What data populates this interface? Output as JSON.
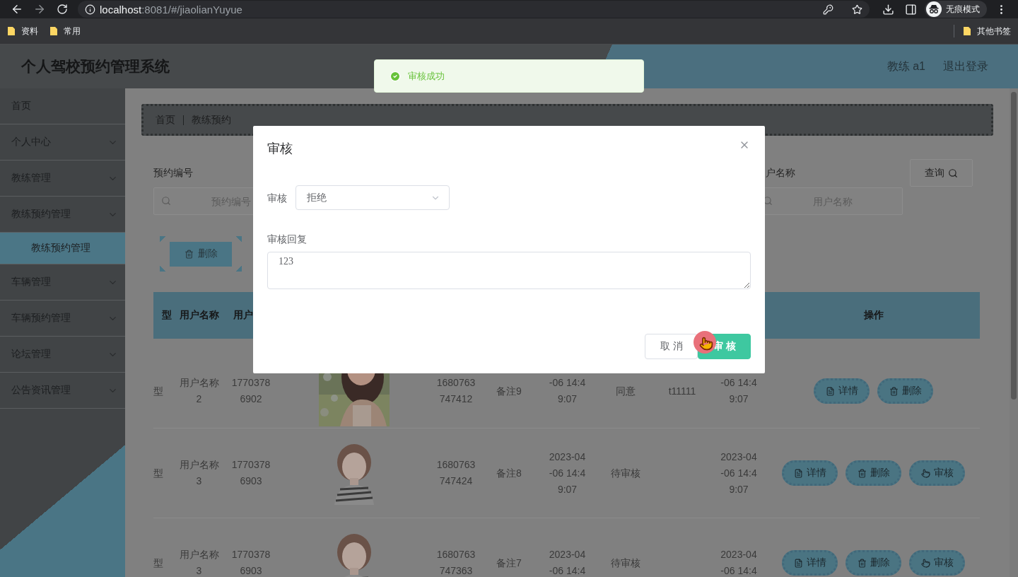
{
  "browser": {
    "url_host": "localhost",
    "url_path": ":8081/#/jiaolianYuyue",
    "profile_label": "无痕模式",
    "bookmarks": [
      "资料",
      "常用"
    ],
    "other_bookmarks": "其他书签"
  },
  "header": {
    "title": "个人驾校预约管理系统",
    "user": "教练 a1",
    "logout": "退出登录"
  },
  "toast": {
    "kind": "success",
    "message": "审核成功"
  },
  "sidebar": {
    "items": [
      {
        "label": "首页",
        "kind": "link"
      },
      {
        "label": "个人中心",
        "kind": "menu"
      },
      {
        "label": "教练管理",
        "kind": "menu"
      },
      {
        "label": "教练预约管理",
        "kind": "menu",
        "children": [
          {
            "label": "教练预约管理",
            "selected": true
          }
        ]
      },
      {
        "label": "车辆管理",
        "kind": "menu"
      },
      {
        "label": "车辆预约管理",
        "kind": "menu"
      },
      {
        "label": "论坛管理",
        "kind": "menu"
      },
      {
        "label": "公告资讯管理",
        "kind": "menu"
      }
    ]
  },
  "breadcrumb": [
    "首页",
    "教练预约"
  ],
  "search": {
    "fields": [
      {
        "label": "预约编号",
        "placeholder": "预约编号"
      },
      {
        "label": "户名称",
        "placeholder": "用户名称"
      }
    ],
    "button": "查询"
  },
  "toolbar": {
    "delete_button": "删除"
  },
  "table": {
    "columns": [
      {
        "label": "型",
        "kind": "text"
      },
      {
        "label": "用户名称",
        "kind": "text"
      },
      {
        "label": "用户",
        "kind": "text"
      },
      {
        "label": "操作",
        "kind": "actions"
      }
    ],
    "rows": [
      {
        "column_1": "型",
        "user_name": "用户名称2",
        "column_3": "17703786902",
        "column_4": {
          "kind": "picture"
        },
        "column_5": "1680763747412",
        "column_6": "备注9",
        "column_7": "-06 14:49:07",
        "column_8": "同意",
        "column_9": "t11111",
        "column_10": "-06 14:49:07",
        "actions": [
          {
            "kind": "detail",
            "label": "详情"
          },
          {
            "kind": "delete",
            "label": "删除"
          }
        ]
      },
      {
        "column_1": "型",
        "user_name": "用户名称3",
        "column_3": "17703786903",
        "column_4": {
          "kind": "picture"
        },
        "column_5": "1680763747424",
        "column_6": "备注8",
        "column_7": "2023-04-06 14:49:07",
        "column_8": "待审核",
        "column_10": "2023-04-06 14:49:07",
        "actions": [
          {
            "kind": "detail",
            "label": "详情"
          },
          {
            "kind": "delete",
            "label": "删除"
          },
          {
            "kind": "review",
            "label": "审核"
          }
        ]
      },
      {
        "column_1": "型",
        "user_name": "用户名称3",
        "column_3": "17703786903",
        "column_4": {
          "kind": "picture"
        },
        "column_5": "1680763747363",
        "column_6": "备注7",
        "column_7": "2023-04-06 14:4",
        "column_8": "待审核",
        "column_10": "2023-04-06 14:4",
        "actions": [
          {
            "kind": "detail",
            "label": "详情"
          },
          {
            "kind": "delete",
            "label": "删除"
          },
          {
            "kind": "review",
            "label": "审核"
          }
        ]
      }
    ]
  },
  "dialog": {
    "title": "审核",
    "fields": [
      {
        "kind": "select",
        "label": "审核",
        "value": "拒绝"
      },
      {
        "kind": "textarea",
        "label": "审核回复",
        "value": "123"
      }
    ],
    "buttons": [
      {
        "kind": "secondary",
        "label": "取消"
      },
      {
        "kind": "primary",
        "label": "审核"
      }
    ]
  }
}
